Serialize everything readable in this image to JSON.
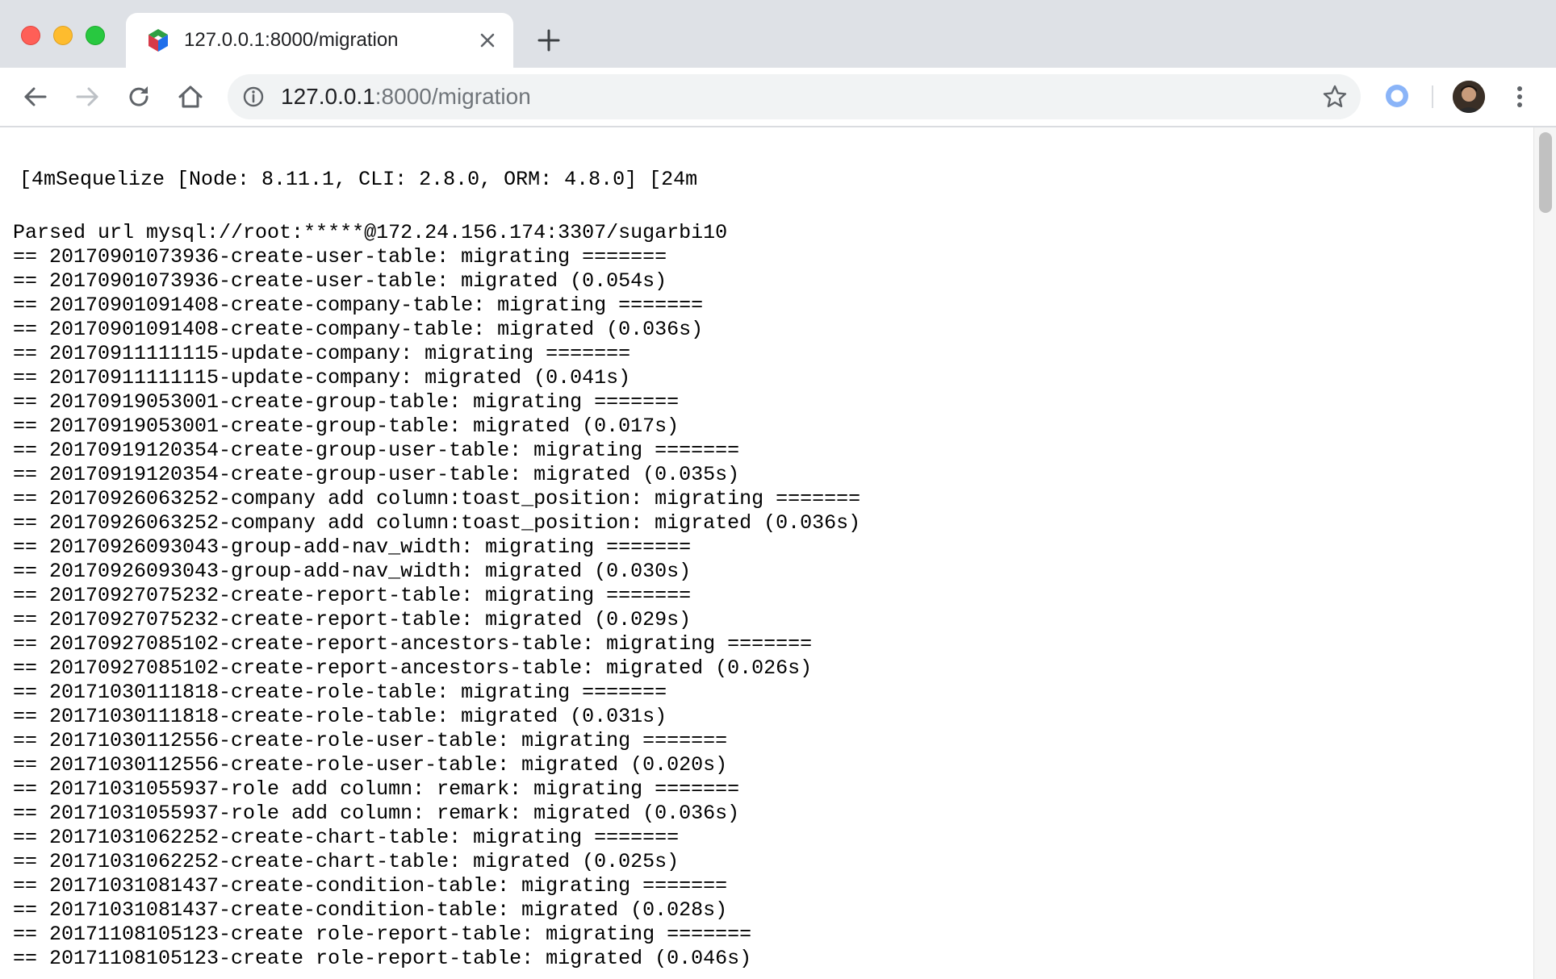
{
  "browser": {
    "tab": {
      "title": "127.0.0.1:8000/migration"
    },
    "address": {
      "host": "127.0.0.1",
      "rest": ":8000/migration"
    },
    "icons": {
      "close": "close-icon",
      "new_tab": "plus-icon",
      "back": "arrow-left-icon",
      "forward": "arrow-right-icon",
      "reload": "reload-icon",
      "home": "home-icon",
      "info": "info-icon",
      "bookmark": "star-icon",
      "extension": "extension-icon",
      "menu": "kebab-menu-icon"
    }
  },
  "log": {
    "header": "[4mSequelize [Node: 8.11.1, CLI: 2.8.0, ORM: 4.8.0] [24m",
    "lines": [
      "Parsed url mysql://root:*****@172.24.156.174:3307/sugarbi10",
      "== 20170901073936-create-user-table: migrating =======",
      "== 20170901073936-create-user-table: migrated (0.054s)",
      "== 20170901091408-create-company-table: migrating =======",
      "== 20170901091408-create-company-table: migrated (0.036s)",
      "== 20170911111115-update-company: migrating =======",
      "== 20170911111115-update-company: migrated (0.041s)",
      "== 20170919053001-create-group-table: migrating =======",
      "== 20170919053001-create-group-table: migrated (0.017s)",
      "== 20170919120354-create-group-user-table: migrating =======",
      "== 20170919120354-create-group-user-table: migrated (0.035s)",
      "== 20170926063252-company add column:toast_position: migrating =======",
      "== 20170926063252-company add column:toast_position: migrated (0.036s)",
      "== 20170926093043-group-add-nav_width: migrating =======",
      "== 20170926093043-group-add-nav_width: migrated (0.030s)",
      "== 20170927075232-create-report-table: migrating =======",
      "== 20170927075232-create-report-table: migrated (0.029s)",
      "== 20170927085102-create-report-ancestors-table: migrating =======",
      "== 20170927085102-create-report-ancestors-table: migrated (0.026s)",
      "== 20171030111818-create-role-table: migrating =======",
      "== 20171030111818-create-role-table: migrated (0.031s)",
      "== 20171030112556-create-role-user-table: migrating =======",
      "== 20171030112556-create-role-user-table: migrated (0.020s)",
      "== 20171031055937-role add column: remark: migrating =======",
      "== 20171031055937-role add column: remark: migrated (0.036s)",
      "== 20171031062252-create-chart-table: migrating =======",
      "== 20171031062252-create-chart-table: migrated (0.025s)",
      "== 20171031081437-create-condition-table: migrating =======",
      "== 20171031081437-create-condition-table: migrated (0.028s)",
      "== 20171108105123-create role-report-table: migrating =======",
      "== 20171108105123-create role-report-table: migrated (0.046s)"
    ]
  }
}
